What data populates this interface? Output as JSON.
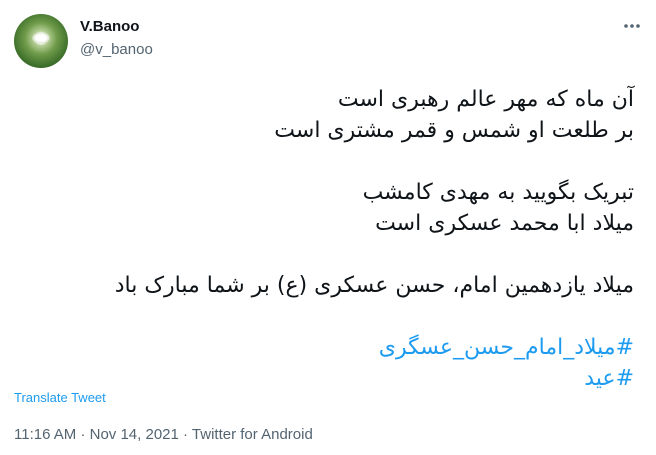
{
  "author": {
    "display_name": "V.Banoo",
    "handle": "@v_banoo"
  },
  "icons": {
    "more": "more-dots-icon"
  },
  "tweet": {
    "lines": [
      "آن ماه که مهر عالم رهبری است",
      "بر طلعت او شمس و قمر مشتری است",
      "تبریک بگویید به مهدی کامشب",
      "میلاد ابا محمد عسکری است",
      "میلاد یازدهمین امام، حسن عسکری (ع) بر شما مبارک باد"
    ],
    "hashtags": [
      "#میلاد_امام_حسن_عسگری",
      "#عید"
    ]
  },
  "translate_label": "Translate Tweet",
  "meta": {
    "time": "11:16 AM",
    "date": "Nov 14, 2021",
    "source": "Twitter for Android",
    "separator": "·"
  },
  "colors": {
    "link": "#1d9bf0",
    "secondary_text": "#536471",
    "primary_text": "#0f1419"
  }
}
